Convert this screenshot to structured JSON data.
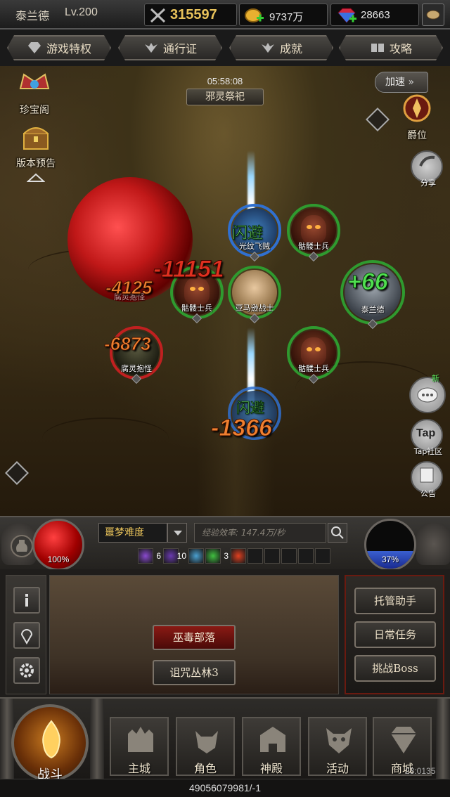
{
  "topbar": {
    "player_name": "泰兰德",
    "level": "Lv.200",
    "combat_power": "315597",
    "gold": "9737万",
    "gems": "28663",
    "power_icon": "crossed-swords-icon",
    "gold_icon": "gold-coin-icon",
    "gem_icon": "gem-icon"
  },
  "nav": [
    {
      "label": "游戏特权",
      "icon": "diamond-icon"
    },
    {
      "label": "通行证",
      "icon": "wings-icon"
    },
    {
      "label": "成就",
      "icon": "wings-icon"
    },
    {
      "label": "攻略",
      "icon": "book-icon"
    }
  ],
  "scene": {
    "timer": "05:58:08",
    "event_name": "邪灵祭祀",
    "speed_label": "加速",
    "treasure_label": "珍宝阁",
    "preview_label": "版本预告",
    "rank_label": "爵位",
    "share_label": "分享",
    "tap_title": "Tap",
    "tap_label": "Tap社区",
    "notice_label": "公告",
    "chat_badge": "新"
  },
  "units": [
    {
      "name": "骷髅士兵",
      "side": "ally"
    },
    {
      "name": "光纹飞贼",
      "side": "ally"
    },
    {
      "name": "骷髅士兵",
      "side": "ally"
    },
    {
      "name": "亚马逊战士",
      "side": "ally"
    },
    {
      "name": "泰兰德",
      "side": "ally"
    },
    {
      "name": "腐灵抱怪",
      "side": "enemy"
    },
    {
      "name": "骷髅士兵",
      "side": "ally"
    },
    {
      "name": "腐灵抱怪",
      "side": "enemy"
    }
  ],
  "combat_text": {
    "dmg1": "-11151",
    "dmg2": "-4125",
    "dmg3": "-6873",
    "dmg4": "-1366",
    "heal": "+66",
    "dodge": "闪避"
  },
  "status": {
    "hp_percent": "100%",
    "mp_percent": "37%",
    "mp_fraction": 0.37,
    "difficulty": "噩梦难度",
    "exp_rate": "经验效率: 147.4万/秒",
    "buffs": [
      {
        "count": "6",
        "color": "#8a4ad0"
      },
      {
        "count": "10",
        "color": "#6a3ab0"
      },
      {
        "count": "",
        "color": "#4aa0d0"
      },
      {
        "count": "3",
        "color": "#40c040"
      },
      {
        "count": "",
        "color": "#e04020"
      }
    ]
  },
  "map": {
    "location_current": "巫毒部落",
    "location_next": "诅咒丛林3"
  },
  "right_panel": {
    "auto_assist": "托管助手",
    "daily_tasks": "日常任务",
    "boss_challenge": "挑战Boss"
  },
  "bottom_nav": {
    "battle": "战斗",
    "tiles": [
      {
        "label": "主城",
        "icon": "castle-icon"
      },
      {
        "label": "角色",
        "icon": "helmet-icon"
      },
      {
        "label": "神殿",
        "icon": "temple-icon"
      },
      {
        "label": "活动",
        "icon": "demon-icon"
      },
      {
        "label": "商城",
        "icon": "diamond-icon"
      }
    ]
  },
  "footer": {
    "id_text": "49056079981/-1",
    "coord": "23:0135"
  }
}
